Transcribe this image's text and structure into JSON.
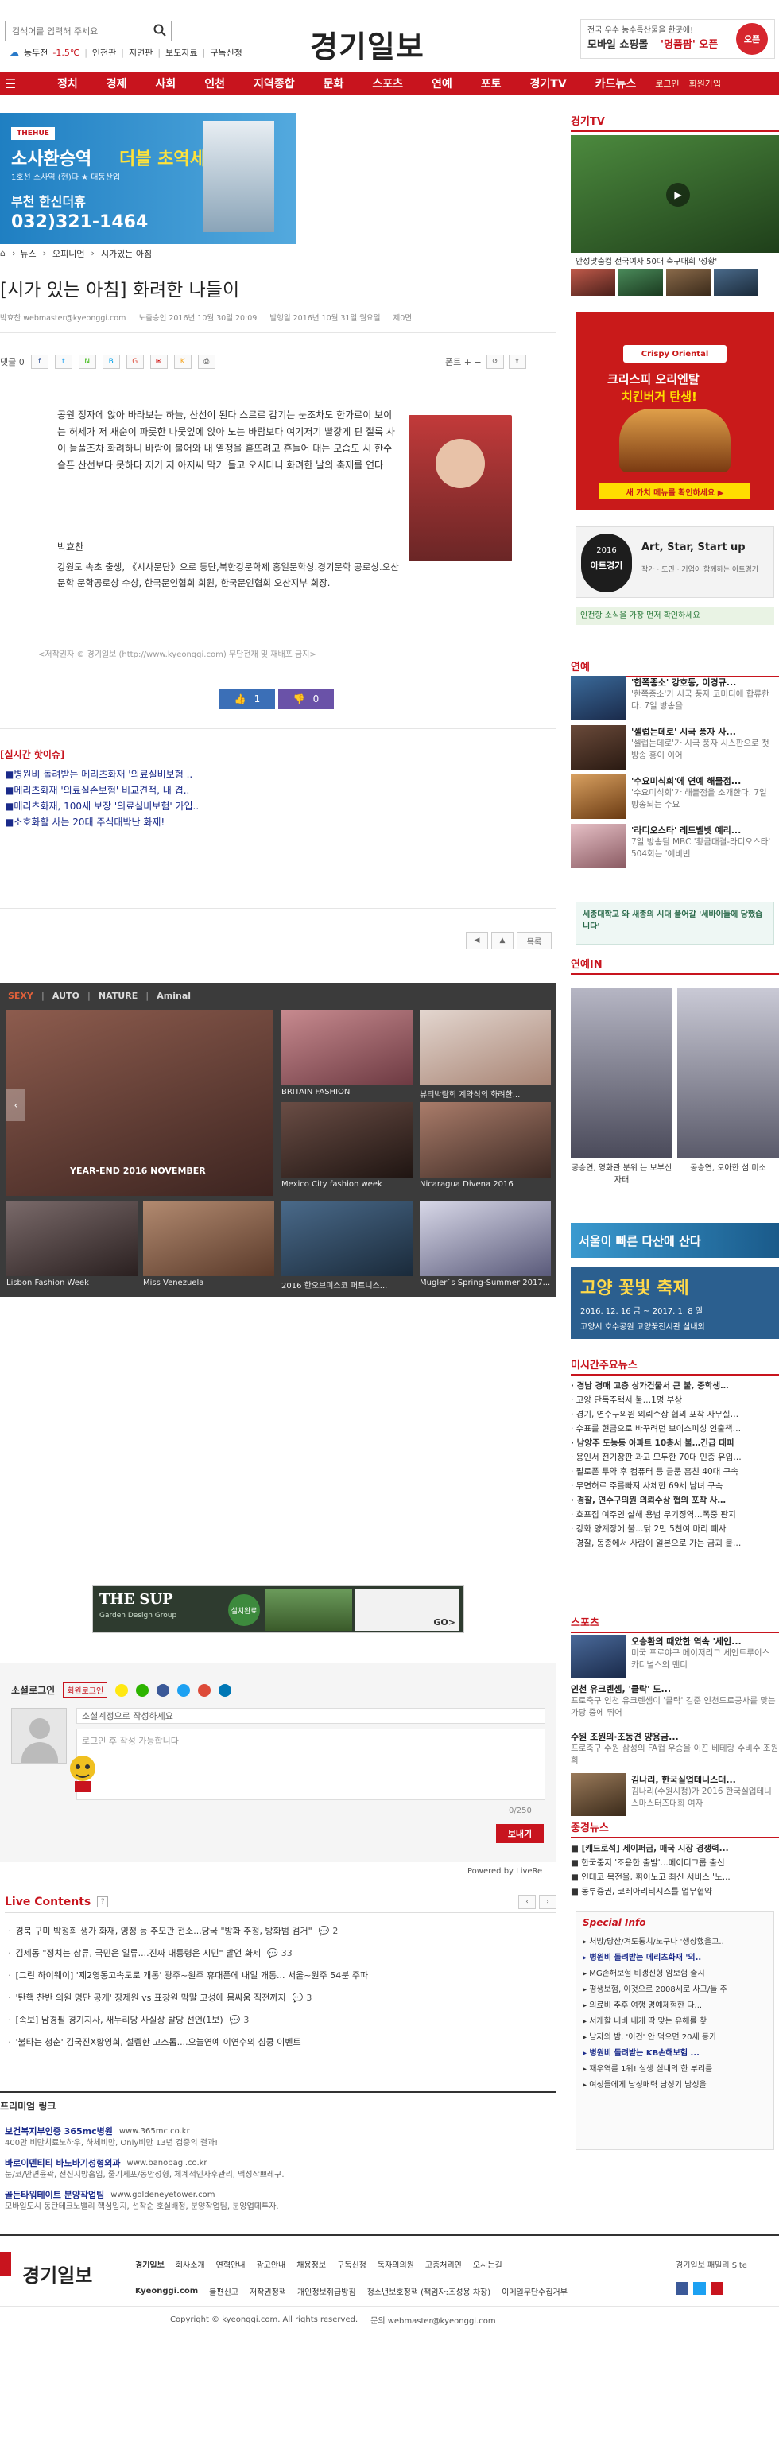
{
  "header": {
    "search_placeholder": "검색어를 입력해 주세요",
    "weather": [
      "동두천",
      "-1.5℃",
      "인천판",
      "지면판",
      "보도자료",
      "구독신청"
    ],
    "logo": "경기일보",
    "ad": {
      "line1": "전국 우수 농수특산물을 한곳에!",
      "line2": "모바일 쇼핑몰",
      "line3": "'명품팜' 오픈",
      "badge": "오픈"
    }
  },
  "nav": {
    "items": [
      "정치",
      "경제",
      "사회",
      "인천",
      "지역종합",
      "문화",
      "스포츠",
      "연예",
      "포토",
      "경기TV",
      "카드뉴스"
    ],
    "extra": [
      "로그인",
      "회원가입"
    ]
  },
  "ad_banner": {
    "line1": "소사환승역",
    "line2": "더블 초역세권!",
    "line3": "1호선 소사역 (현)다 ★ 대동산업",
    "line4": "부천 한신더휴",
    "phone": "032)321-1464"
  },
  "breadcrumb": [
    "뉴스",
    "오피니언",
    "시가있는 아침"
  ],
  "article": {
    "title": "[시가 있는 아침] 화려한 나들이",
    "meta": [
      "박효찬 webmaster@kyeonggi.com",
      "노출승인 2016년 10월 30일 20:09",
      "발행일 2016년 10월 31일 월요일",
      "제0면"
    ],
    "tools_left": "댓글 0",
    "tools_right": "폰트  +  −",
    "body": "공원 정자에 앉아 바라보는 하늘, 산선이 된다 스르르 감기는 눈조차도 한가로이 보이는 허세가 저 새순이 파릇한 나뭇잎에 앉아 노는 바람보다 여기저기 빨갛게 핀 절룩 사이 들풀조차 화려하니 바람이 불어와 내 열정을 흩뜨려고 흔들어 대는 모습도 시 한수 슬픈 산선보다 못하다 저기 저 아저씨 막기 들고 오시더니 화려한 날의 축제를 연다",
    "author_name": "박효찬",
    "author_bio": "강원도 속초 출생, 《시사문단》으로 등단,북한강문학제 홍일문학상.경기문학 공로상.오산문학 문학공로상 수상, 한국문인협회 회원, 한국문인협회 오산지부 회장.",
    "copyright": "<저작권자 © 경기일보 (http://www.kyeonggi.com) 무단전재 및 재배포 금지>",
    "like": "1",
    "dislike": "0"
  },
  "related": {
    "title": "[실시간 핫이슈]",
    "items": [
      "■병원비 돌려받는 메리츠화재 '의료실비보험 ..",
      "■메리츠화재 '의료실손보험' 비교견적, 내 겹..",
      "■메리츠화재, 100세 보장 '의료실비보험' 가입..",
      "■소호화할 사는 20대 주식대박난 화제!"
    ]
  },
  "pager": [
    "◀",
    "▲",
    "목록"
  ],
  "gallery": {
    "tabs": [
      "SEXY",
      "AUTO",
      "NATURE",
      "Aminal"
    ],
    "big_caption": "YEAR-END 2016 NOVEMBER",
    "captions": [
      "BRITAIN FASHION",
      "뷰티박람회 계약식의 화려한...",
      "Mexico City fashion week",
      "Nicaragua Divena 2016",
      "Lisbon Fashion Week",
      "Miss Venezuela",
      "2016 한오브미스코 퍼트니스...",
      "Mugler`s Spring-Summer 2017..."
    ]
  },
  "bottom_ad": {
    "brand": "THE SUP",
    "sub": "Garden Design Group",
    "tag": "설치완료",
    "right": "GO>"
  },
  "social": {
    "title": "소셜로그인",
    "login_badge": "회원로그인",
    "input_hint": "소셜계정으로 작성하세요",
    "textarea": "로그인 후 작성 가능합니다",
    "counter": "0/250",
    "submit": "보내기",
    "powered": "Powered by LiveRe"
  },
  "live": {
    "title": "Live Contents",
    "items": [
      "경북 구미 박정희 생가 화재, 영정 등 추모관 전소...당국 \"방화 추정, 방화범 검거\"",
      "김제동 \"정치는 삼류, 국민은 일류....진짜 대통령은 시민\" 발언 화제",
      "[그린 하이웨이] '제2영동고속도로 개통' 광주~원주 휴대폰에 내일 개통... 서울~원주 54분 주파",
      "'탄핵 찬반 의원 명단 공개' 장제원 vs 표창원 막말 고성에 몸싸움 직전까지",
      "[속보] 남경필 경기지사, 새누리당 사실상 탈당 선언(1보)",
      "'불타는 청춘' 김국진X황영희, 설렘한 고스톱....오늘연예 이연수의 심쿵 이벤트"
    ],
    "counts": [
      "2",
      "33",
      "",
      "3",
      "3",
      ""
    ]
  },
  "premium": {
    "title": "프리미엄 링크",
    "items": [
      {
        "name": "보건복지부인증 365mc병원",
        "url": "www.365mc.co.kr",
        "desc": "400만 비만치료노하우, 하체비만, Only비만 13년 검증의 결과!"
      },
      {
        "name": "바로이덴티티 바노바기성형외과",
        "url": "www.banobagi.co.kr",
        "desc": "눈/코/안면윤곽, 전신지방흡입, 줄기세포/동안성형, 체계적인사후관리, 맥성작쁘레구."
      },
      {
        "name": "골든타워테이트 분양작업팀",
        "url": "www.goldeneyetower.com",
        "desc": "모바일도시 동탄테크노밸리 핵심입지, 선착순 호실배정, 분양작업팀, 분양업데투자."
      }
    ]
  },
  "footer": {
    "logo": "경기일보",
    "links1": [
      "경기일보",
      "회사소개",
      "연혁안내",
      "광고안내",
      "채용정보",
      "구독신청",
      "독자의의원",
      "고충처리인",
      "오시는길"
    ],
    "links2": [
      "Kyeonggi.com",
      "불편신고",
      "저작권정책",
      "개인정보취급방침",
      "청소년보호정책 (책임자:조성용 차장)",
      "이메일무단수집거부"
    ],
    "site_label": "경기일보 패밀리 Site",
    "copyright": "Copyright © kyeonggi.com. All rights reserved.",
    "contact": "문의 webmaster@kyeonggi.com"
  },
  "sidebar": {
    "tv_title": "경기TV",
    "tv_caption": "안성맞춤컵 전국여자 50대 축구대회 '성황'",
    "mc_line1": "크리스피 오리엔탈",
    "mc_line2": "치킨버거 탄생!",
    "mc_btn": "새 가치 메뉴를 확인하세요 ▶",
    "expo": {
      "year": "2016",
      "name": "아트경기",
      "tagline": "Art, Star, Start up",
      "sub": "작가 · 도민 · 기업이 함께하는 아트경기"
    },
    "farm_text": "인천항 소식을 가장 먼저 확인하세요",
    "ent_title": "연예",
    "ent_items": [
      {
        "title": "'한쪽종소' 강호동, 이경규...",
        "desc": "'한쪽종소'가 시국 풍자 코미디에 합류한다. 7일 방송을"
      },
      {
        "title": "'셀럽는데로' 시국 풍자 사...",
        "desc": "'셀럽는데로'가 시국 풍자 시스판으로 첫방송 흥이 이어"
      },
      {
        "title": "'수요미식회'에 연예 해물점...",
        "desc": "'수요미식회'가 해물점을 소개한다. 7일 방송되는 수요"
      },
      {
        "title": "'라디오스타' 레드벨벳 예리...",
        "desc": "7일 방송될 MBC '황금대결-라디오스타' 504회는 '예비번"
      }
    ],
    "smu_text": "세종대학교 와 새종의 시대 풀어갈 '세바이들에 당했습니다'",
    "entin_title": "연예IN",
    "entin_captions": [
      "공승연, 영화관 분위 는 보부신 자태",
      "공승연, 오아한 섬 미소"
    ],
    "seoul_banner": "서울이 빠른 다산에 산다",
    "flower": {
      "title": "고양 꽃빛 축제",
      "date": "2016. 12. 16 금 ~ 2017. 1. 8 일",
      "place": "고양시 호수공원 고양꽃전시관 실내외"
    },
    "realtime_title": "미시간주요뉴스",
    "realtime_items": [
      "· 경남 경매 고층 상가건물서 큰 불, 중학생…",
      "· 고양 단독주택서 불…1명 부상",
      "· 경기, 연수구의원 의뢰수상 협의 포착 사무실…",
      "· 수표를 현금으로 바꾸려던 보이스피싱 인출책…",
      "· 남양주 도농동 아파트 10층서 불…긴급 대피",
      "· 용인서 전기장판 과고 모두한 70대 민중 유입…",
      "· 필로폰 투약 후 컴퓨터 등 금품 훔친 40대 구속",
      "· 무면허로 주를빠져 사체한 69세 남녀 구속",
      "· 경찰, 연수구의원 의뢰수상 협의 포착 사…",
      "· 호프집 여주인 살해 용범 무기징역…폭중 판지",
      "· 강화 양계장에 불…닭 2만 5천여 마리 폐사",
      "· 경찰, 동종에서 사람이 일본으로 가는 금괴 붙…"
    ],
    "sports_title": "스포츠",
    "sports_items": [
      {
        "title": "오승환의 때았한 역속 '세인...",
        "desc": "미국 프로야구 메이저리그 세인트루이스 카디널스의 맨디"
      },
      {
        "title": "인천 유크렌셈, '클락' 도...",
        "desc": "프로축구 인천 유크렌셈이 '클락' 김준 인천도로공사를 맞는 가당 중에 뛰어"
      },
      {
        "title": "수원 조원의·조동견 양용금...",
        "desc": "프로축구 수원 삼성의 FA컵 우승을 이끈 베테랑 수비수 조원희"
      },
      {
        "title": "김나리, 한국실업테니스대...",
        "desc": "김나리(수원시청)가 2016 한국실업테니스마스터즈대회 여자"
      }
    ],
    "choice_title": "중경뉴스",
    "choice_items": [
      "■ [캐드로석] 세이퍼금, 매국 시장 경쟁력...",
      "■ 한국중지 '조용한 출발'...메이디그룹 출신",
      "■ 인테코 목전을, 휘이노고 최신 서비스 '노...",
      "■ 동부증권, 코레아리티시스를 업무협약"
    ],
    "special_title": "Special Info",
    "special_items": [
      "▸ 처방/당산/겨도통치/노구나 '생상했을고..",
      "▸ 병원비 돌려받는 메리츠화재 '의..",
      "▸ MG손해보험 비갱신형 암보험 출시",
      "▸ 평생보험, 이것으로 2008세로 사고/들 주",
      "▸ 의료비 추후 여행 명예제험한 다...",
      "▸ 서개할 내비 내게 딱 맞는 유해를 찾",
      "▸ 남자의 밤, '이건' 안 먹으면 20세 등가",
      "▸ 병원비 돌려받는 KB손해보험 ...",
      "▸ 재우역를 1위! 실생 실내의 한 부리를",
      "▸ 여성들에게 남성매력 남성기 남성을"
    ]
  }
}
